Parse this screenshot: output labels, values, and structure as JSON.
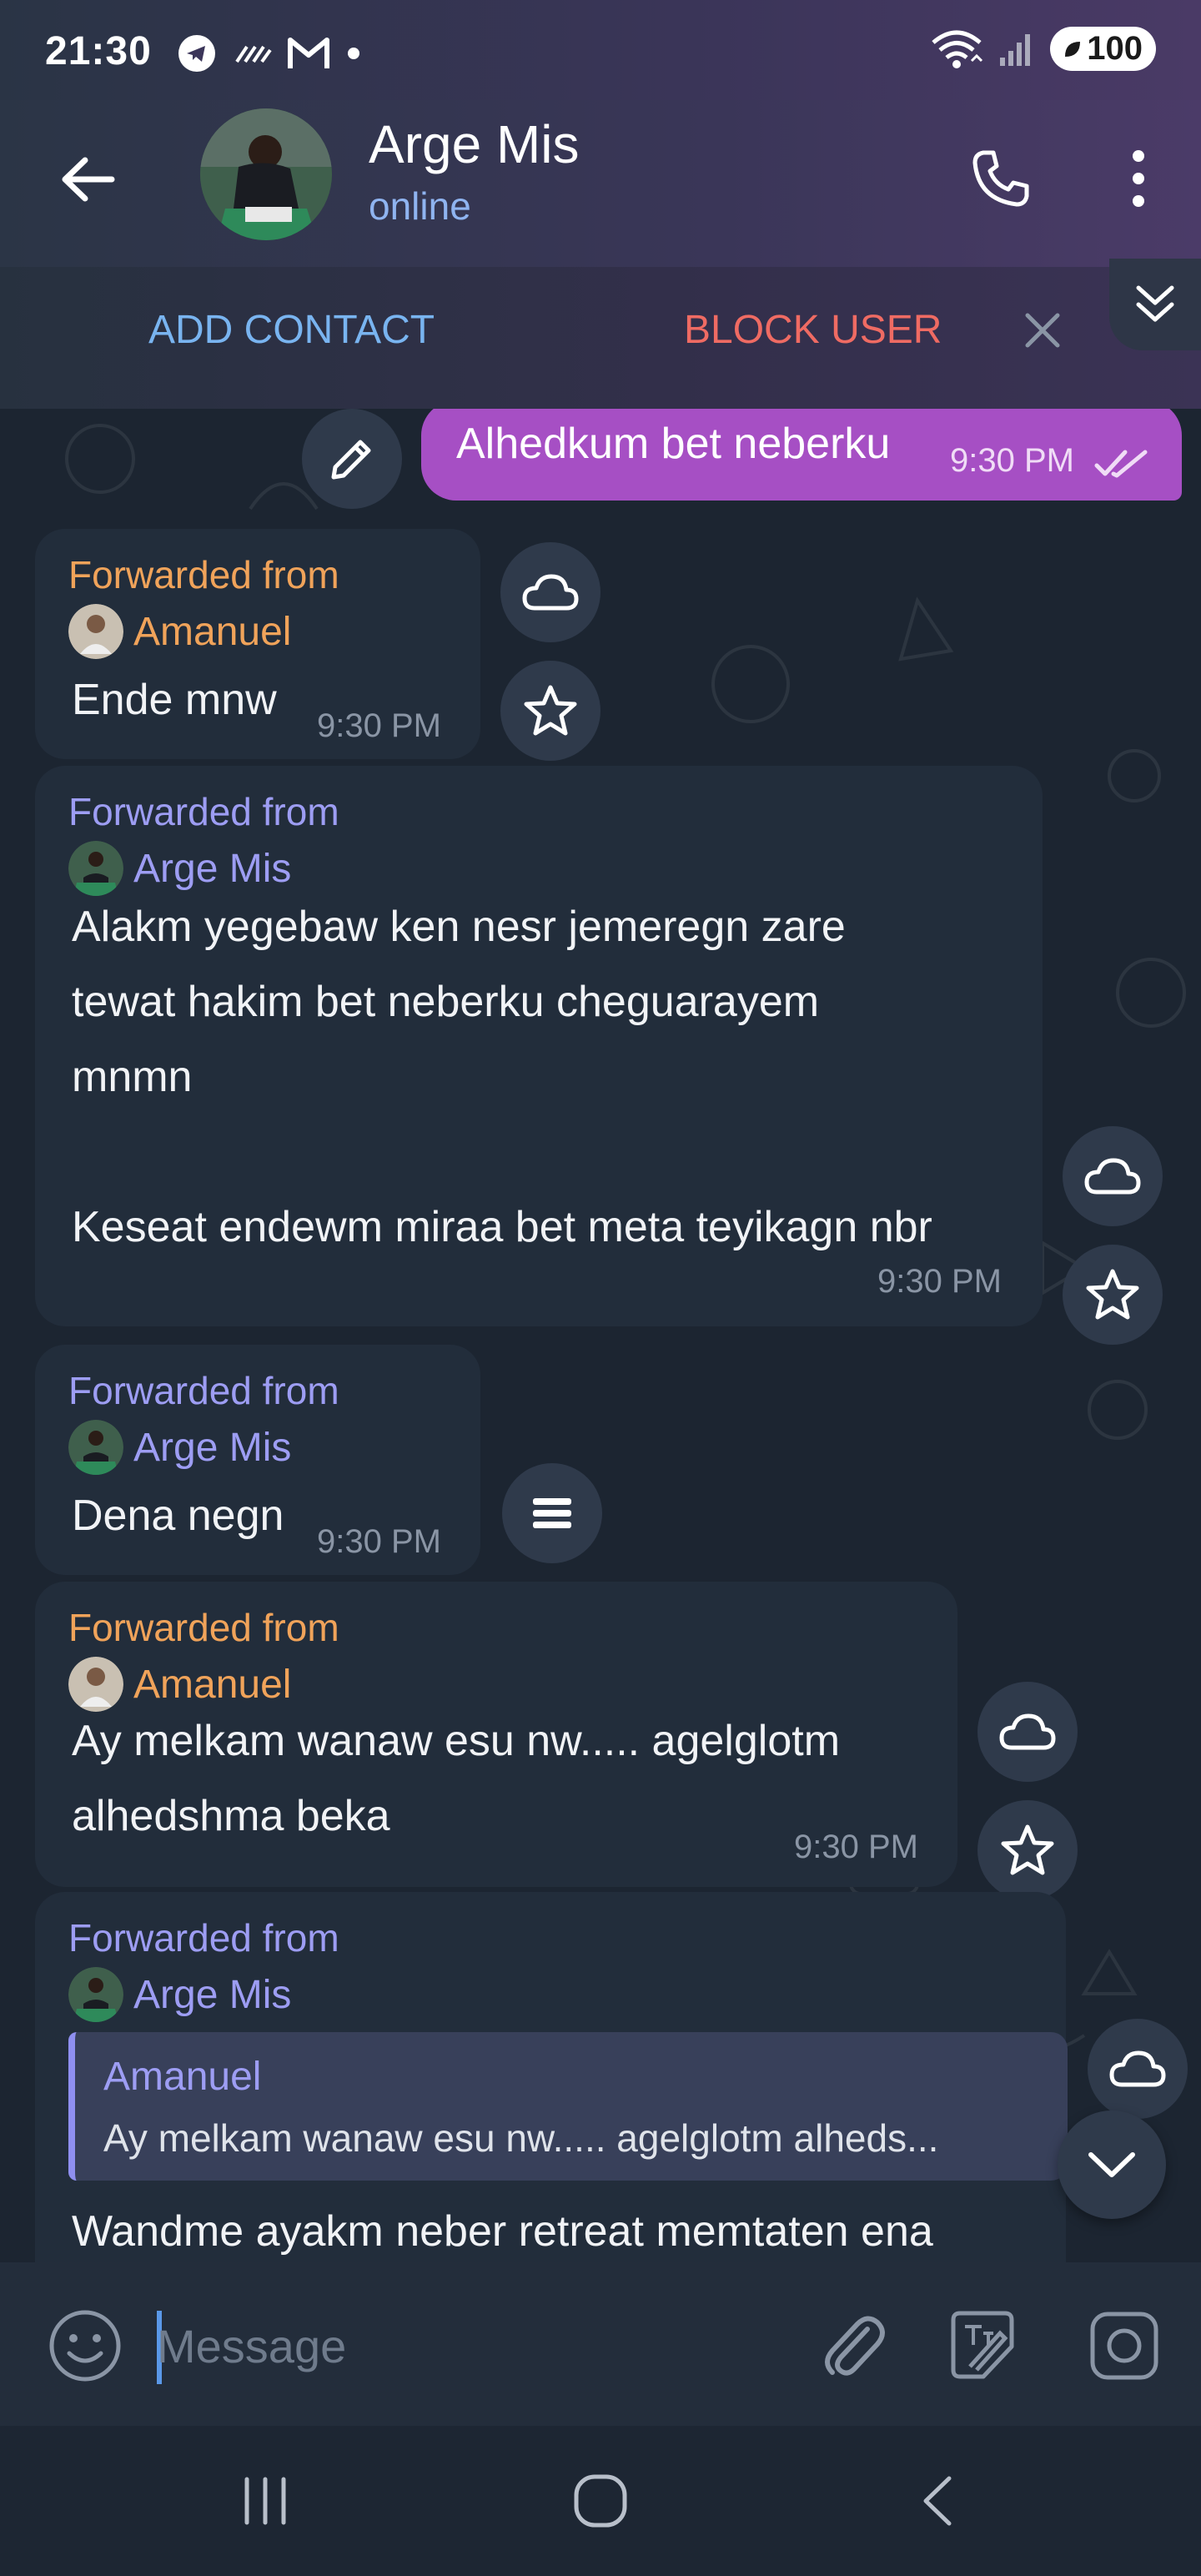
{
  "status_bar": {
    "time": "21:30",
    "battery": "100"
  },
  "header": {
    "title": "Arge Mis",
    "status": "online"
  },
  "action_bar": {
    "add_contact": "ADD CONTACT",
    "block_user": "BLOCK USER"
  },
  "messages": [
    {
      "direction": "out",
      "text": "Alhedkum bet neberku",
      "time": "9:30 PM",
      "read": true
    },
    {
      "direction": "in",
      "forwarded_label": "Forwarded from",
      "sender": "Amanuel",
      "text": "Ende mnw",
      "time": "9:30 PM"
    },
    {
      "direction": "in",
      "forwarded_label": "Forwarded from",
      "sender": "Arge Mis",
      "text": "Alakm yegebaw ken nesr jemeregn zare\ntewat hakim bet neberku cheguarayem\nmnmn\n\nKeseat endewm miraa bet meta teyikagn nbr",
      "time": "9:30 PM"
    },
    {
      "direction": "in",
      "forwarded_label": "Forwarded from",
      "sender": "Arge Mis",
      "text": "Dena negn",
      "time": "9:30 PM"
    },
    {
      "direction": "in",
      "forwarded_label": "Forwarded from",
      "sender": "Amanuel",
      "text": "Ay melkam wanaw esu nw..... agelglotm\nalhedshma beka",
      "time": "9:30 PM"
    },
    {
      "direction": "in",
      "forwarded_label": "Forwarded from",
      "sender": "Arge Mis",
      "reply": {
        "name": "Amanuel",
        "text": "Ay melkam wanaw esu nw..... agelglotm alheds..."
      },
      "text": "Wandme ayakm neber retreat memtaten ena"
    }
  ],
  "input": {
    "placeholder": "Message"
  },
  "colors": {
    "accent_blue": "#79b4f0",
    "danger": "#ef6b63",
    "outgoing_bubble": "#a64fc4",
    "sender_orange": "#f0a35a",
    "sender_violet": "#9d9df3"
  }
}
